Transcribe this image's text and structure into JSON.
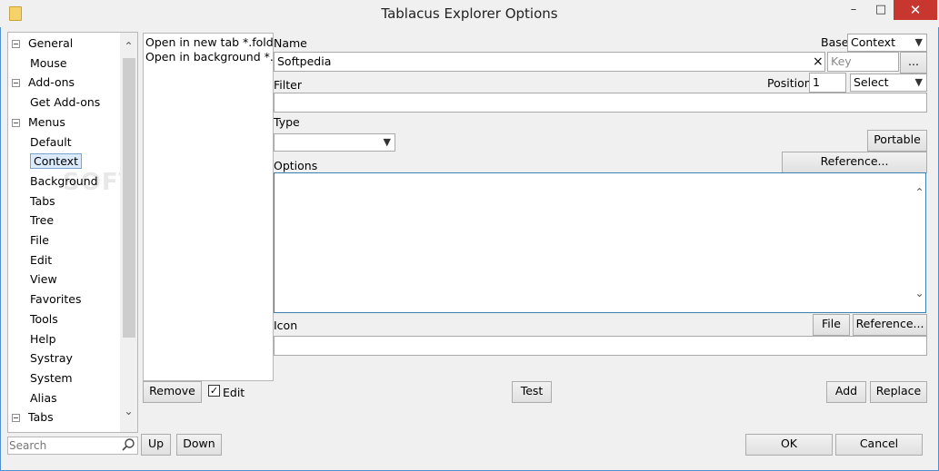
{
  "window": {
    "title": "Tablacus Explorer Options",
    "minimize": "–",
    "maximize": "□",
    "close": "✕"
  },
  "tree": {
    "items": [
      {
        "label": "General",
        "expander": true
      },
      {
        "label": "Mouse"
      },
      {
        "label": "Add-ons",
        "expander": true
      },
      {
        "label": "Get Add-ons"
      },
      {
        "label": "Menus",
        "expander": true
      },
      {
        "label": "Default"
      },
      {
        "label": "Context",
        "selected": true
      },
      {
        "label": "Background"
      },
      {
        "label": "Tabs"
      },
      {
        "label": "Tree"
      },
      {
        "label": "File"
      },
      {
        "label": "Edit"
      },
      {
        "label": "View"
      },
      {
        "label": "Favorites"
      },
      {
        "label": "Tools"
      },
      {
        "label": "Help"
      },
      {
        "label": "Systray"
      },
      {
        "label": "System"
      },
      {
        "label": "Alias"
      },
      {
        "label": "Tabs",
        "expander": true
      }
    ],
    "scroll_up": "⌃",
    "scroll_down": "⌄"
  },
  "search": {
    "placeholder": "Search"
  },
  "list": {
    "items": [
      "Open in new tab *.folder",
      "Open in background *.folder"
    ]
  },
  "form": {
    "name_label": "Name",
    "name_value": "Softpedia",
    "name_clear": "×",
    "base_label": "Base",
    "base_value": "Context",
    "key_placeholder": "Key",
    "key_button": "...",
    "filter_label": "Filter",
    "position_label": "Position",
    "position_value": "1",
    "position_select": "Select",
    "type_label": "Type",
    "portable_button": "Portable",
    "options_label": "Options",
    "reference_button": "Reference...",
    "icon_label": "Icon",
    "file_button": "File",
    "icon_reference_button": "Reference..."
  },
  "actions": {
    "remove": "Remove",
    "edit_label": "Edit",
    "edit_checked": "✓",
    "test": "Test",
    "add": "Add",
    "replace": "Replace",
    "up": "Up",
    "down": "Down",
    "ok": "OK",
    "cancel": "Cancel"
  },
  "watermark": "SOFTPEDIA®"
}
